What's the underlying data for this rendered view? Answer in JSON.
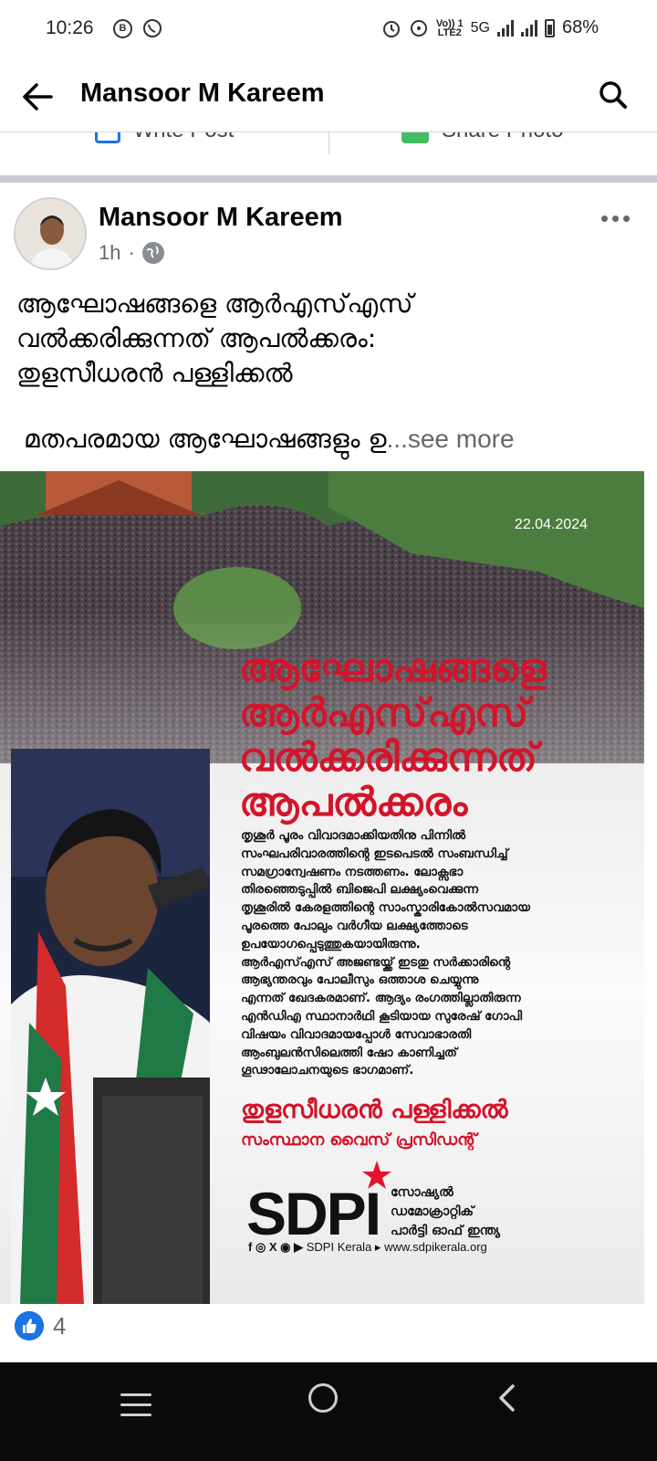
{
  "status_bar": {
    "time": "10:26",
    "app_icons": [
      "B",
      "whatsapp-icon"
    ],
    "network_label_top": "Vo)) 1",
    "network_label_bottom": "LTE2",
    "network_type": "5G",
    "battery_percent": "68%"
  },
  "header": {
    "title": "Mansoor M Kareem",
    "back_icon": "arrow-left-icon",
    "search_icon": "search-icon"
  },
  "composer": {
    "write_post_label": "Write Post",
    "share_photo_label": "Share Photo"
  },
  "post": {
    "author": "Mansoor M Kareem",
    "time": "1h",
    "separator": "·",
    "audience_icon": "globe-icon",
    "text_lines": [
      "ആഘോഷങ്ങളെ ആർഎസ്എസ്",
      "വൽക്കരിക്കുന്നത് ആപൽക്കരം:",
      "തുളസീധരൻ പള്ളിക്കൽ"
    ],
    "excerpt": "മതപരമായ ആഘോഷങ്ങളും ഉ",
    "see_more": "...see more",
    "reactions": {
      "count": "4",
      "icon": "like-icon"
    }
  },
  "poster": {
    "date": "22.04.2024",
    "headline": [
      "ആഘോഷങ്ങളെ",
      "ആർഎസ്എസ്",
      "വൽക്കരിക്കുന്നത്",
      "ആപൽക്കരം"
    ],
    "body_lines": [
      "തൃശൂർ പൂരം വിവാദമാക്കിയതിനു പിന്നിൽ",
      "സംഘപരിവാരത്തിന്റെ ഇടപെടൽ സംബന്ധിച്ച്",
      "സമഗ്രാന്വേഷണം നടത്തണം. ലോക്സഭാ",
      "തിരഞ്ഞെടുപ്പിൽ ബിജെപി ലക്ഷ്യംവെക്കുന്ന",
      "തൃശൂരിൽ കേരളത്തിന്റെ സാംസ്കാരികോൽസവമായ",
      "പൂരത്തെ പോലും വർഗീയ ലക്ഷ്യത്തോടെ",
      "ഉപയോഗപ്പെടുത്തുകയായിരുന്നു.",
      "ആർഎസ്എസ് അജണ്ടയ്ക്ക് ഇടതു സർക്കാരിന്റെ",
      "ആഭ്യന്തരവും പോലീസും ഒത്താശ ചെയ്യുന്നു",
      "എന്നത് ഖേദകരമാണ്. ആദ്യം രംഗത്തില്ലാതിരുന്ന",
      "എൻഡിഎ സ്ഥാനാർഥി കൂടിയായ സുരേഷ് ഗോപി",
      "വിഷയം വിവാദമായപ്പോൾ സേവാഭാരതി",
      "ആംബുലൻസിലെത്തി ഷോ കാണിച്ചത്",
      "ഗൂഢാലോചനയുടെ ഭാഗമാണ്."
    ],
    "speaker_name": "തുളസീധരൻ പള്ളിക്കൽ",
    "speaker_role": "സംസ്ഥാന വൈസ് പ്രസിഡന്റ്",
    "logo_text": "SDPI",
    "logo_sub_lines": [
      "സോഷ്യൽ",
      "ഡമോക്രാറ്റിക്",
      "പാർട്ടി ഓഫ് ഇന്ത്യ"
    ],
    "social_handle": "SDPI Kerala",
    "website": "www.sdpikerala.org",
    "colors": {
      "headline": "#d3142a",
      "body": "#111111"
    }
  },
  "nav_bar": {
    "recents_icon": "recents-icon",
    "home_icon": "home-icon",
    "back_icon": "back-chevron-icon"
  }
}
